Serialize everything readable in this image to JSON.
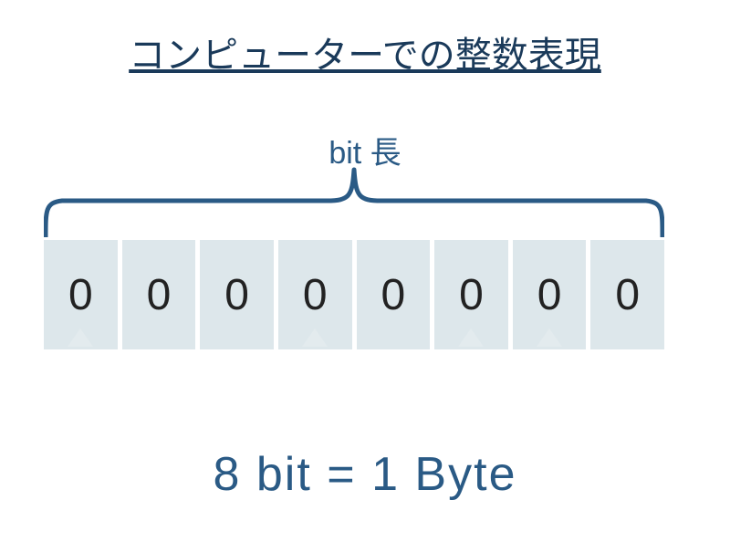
{
  "title": "コンピューターでの整数表現",
  "bit_label": "bit 長",
  "bits": [
    "0",
    "0",
    "0",
    "0",
    "0",
    "0",
    "0",
    "0"
  ],
  "equation": "8 bit  =  1 Byte",
  "colors": {
    "accent": "#2a5a85",
    "title": "#1a3a5a",
    "cell_bg": "#dde7eb"
  }
}
